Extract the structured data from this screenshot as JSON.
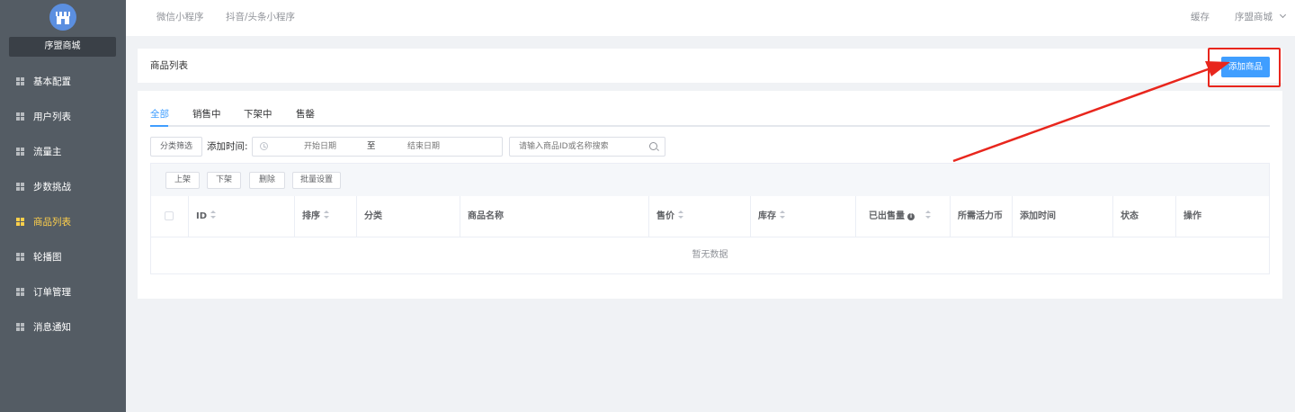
{
  "sidebar": {
    "store_name": "序盟商城",
    "items": [
      {
        "label": "基本配置"
      },
      {
        "label": "用户列表"
      },
      {
        "label": "流量主"
      },
      {
        "label": "步数挑战"
      },
      {
        "label": "商品列表"
      },
      {
        "label": "轮播图"
      },
      {
        "label": "订单管理"
      },
      {
        "label": "消息通知"
      }
    ]
  },
  "topbar": {
    "tabs": [
      {
        "label": "微信小程序"
      },
      {
        "label": "抖音/头条小程序"
      }
    ],
    "cache": "缓存",
    "user": "序盟商城"
  },
  "header": {
    "title": "商品列表",
    "add_button": "添加商品"
  },
  "tabs": [
    {
      "label": "全部"
    },
    {
      "label": "销售中"
    },
    {
      "label": "下架中"
    },
    {
      "label": "售罄"
    }
  ],
  "filters": {
    "category_button": "分类筛选",
    "date_label": "添加时间:",
    "start_placeholder": "开始日期",
    "separator": "至",
    "end_placeholder": "结束日期",
    "search_placeholder": "请输入商品ID或名称搜索"
  },
  "toolbar": {
    "on_shelf": "上架",
    "off_shelf": "下架",
    "delete": "删除",
    "batch": "批量设置"
  },
  "table": {
    "columns": [
      "ID",
      "排序",
      "分类",
      "商品名称",
      "售价",
      "库存",
      "已出售量",
      "所需活力币",
      "添加时间",
      "状态",
      "操作"
    ],
    "empty_text": "暂无数据"
  },
  "colors": {
    "sidebar_bg": "#545c64",
    "active_menu": "#ffd04b",
    "primary": "#409eff",
    "highlight": "#e8261d"
  }
}
